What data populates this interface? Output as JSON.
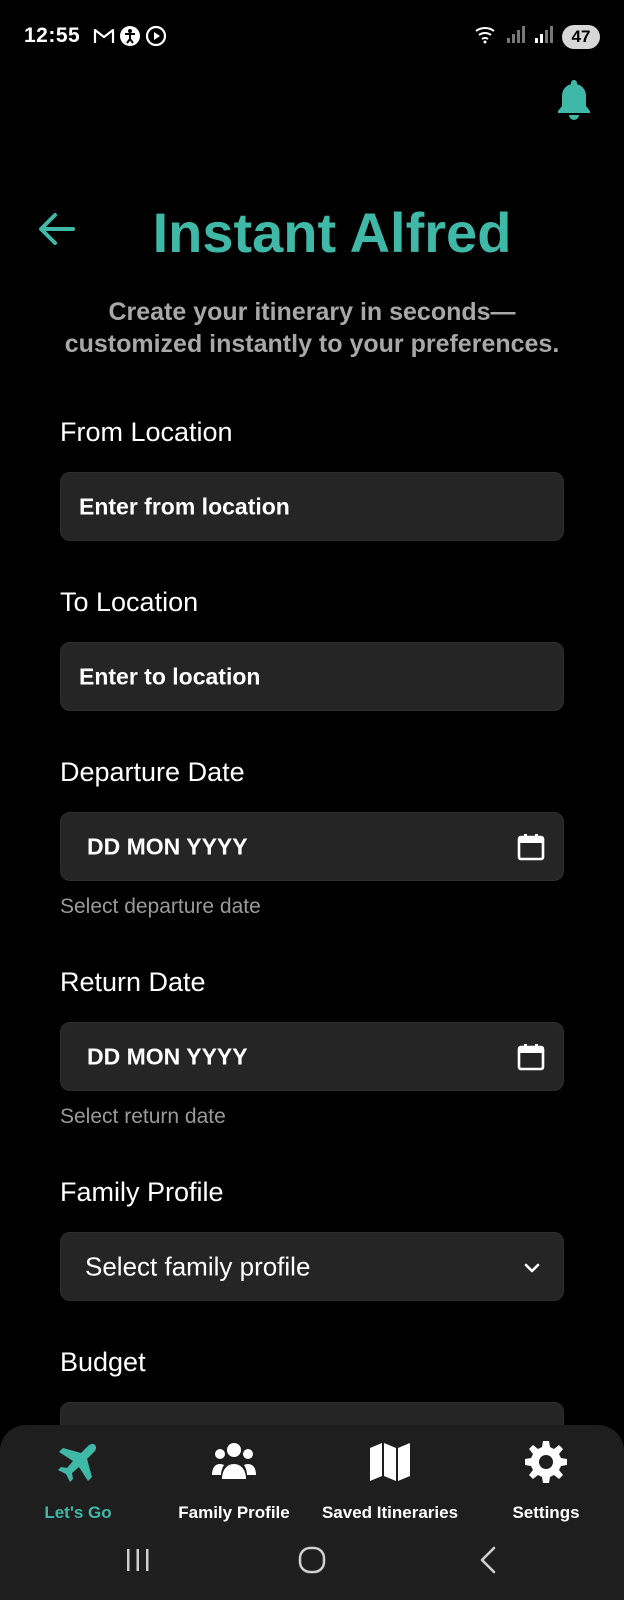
{
  "status_bar": {
    "time": "12:55",
    "battery": "47"
  },
  "header": {
    "title": "Instant Alfred",
    "subtitle": "Create your itinerary in seconds—customized instantly to your preferences."
  },
  "form": {
    "from": {
      "label": "From Location",
      "placeholder": "Enter from location"
    },
    "to": {
      "label": "To Location",
      "placeholder": "Enter to location"
    },
    "departure": {
      "label": "Departure Date",
      "value": "DD MON YYYY",
      "helper": "Select departure date"
    },
    "return": {
      "label": "Return Date",
      "value": "DD MON YYYY",
      "helper": "Select return date"
    },
    "family": {
      "label": "Family Profile",
      "value": "Select family profile"
    },
    "budget": {
      "label": "Budget"
    }
  },
  "nav": {
    "items": [
      {
        "label": "Let's Go",
        "icon": "plane-icon",
        "active": true
      },
      {
        "label": "Family Profile",
        "icon": "users-icon",
        "active": false
      },
      {
        "label": "Saved Itineraries",
        "icon": "map-icon",
        "active": false
      },
      {
        "label": "Settings",
        "icon": "gear-icon",
        "active": false
      }
    ]
  },
  "colors": {
    "accent": "#3fb8a8",
    "background": "#000000",
    "field": "#252525",
    "nav_bg": "#1e1e1e"
  }
}
